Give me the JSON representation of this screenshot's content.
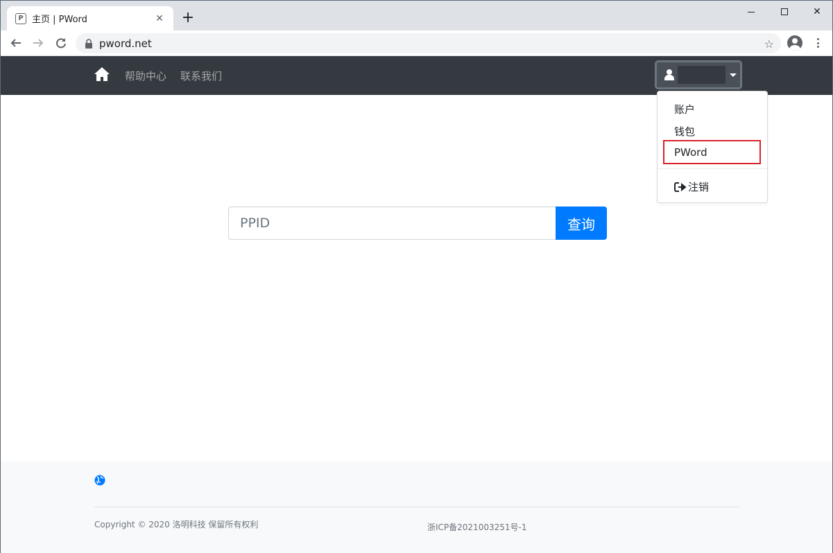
{
  "browser": {
    "tab_title": "主页 | PWord",
    "tab_favicon": "P",
    "close_glyph": "✕",
    "new_tab_glyph": "+",
    "url": "pword.net",
    "star_glyph": "☆",
    "window_close_glyph": "✕"
  },
  "navbar": {
    "help_label": "帮助中心",
    "contact_label": "联系我们"
  },
  "dropdown": {
    "items": [
      {
        "label": "账户"
      },
      {
        "label": "钱包"
      },
      {
        "label": "PWord"
      }
    ],
    "logout_label": "注销"
  },
  "search": {
    "placeholder": "PPID",
    "button_label": "查询"
  },
  "footer": {
    "copyright": "Copyright © 2020 洛明科技 保留所有权利",
    "icp": "浙ICP备2021003251号-1"
  },
  "colors": {
    "navbar_bg": "#343a40",
    "primary": "#007bff",
    "highlight": "#d9212c"
  }
}
